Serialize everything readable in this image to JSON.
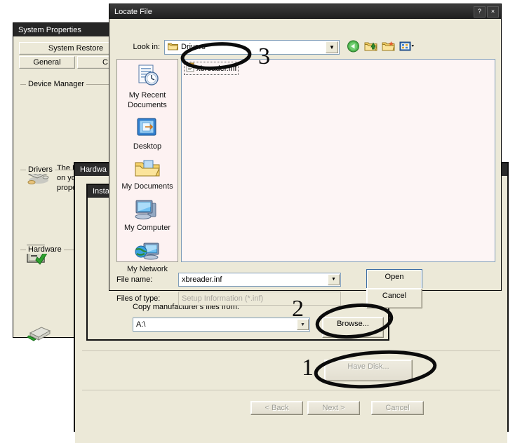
{
  "system_properties": {
    "title": "System Properties",
    "tabs": [
      "System Restore",
      "General",
      "C"
    ],
    "groups": [
      {
        "title": "Device Manager",
        "icon": "device-manager-icon",
        "text_lines": [
          "The Devic",
          "on your co",
          "properties"
        ]
      },
      {
        "title": "Drivers",
        "icon": "driver-signing-icon",
        "text_lines": []
      },
      {
        "title": "Hardware",
        "icon": "hardware-profiles-icon",
        "text_lines": []
      }
    ]
  },
  "hardware_wizard": {
    "title": "Hardwa",
    "buttons": {
      "have_disk": "Have Disk...",
      "back": "< Back",
      "next": "Next >",
      "cancel": "Cancel"
    }
  },
  "install_from_disk": {
    "title": "Insta",
    "copy_from_label": "Copy manufacturer's files from:",
    "path_value": "A:\\",
    "browse_label": "Browse..."
  },
  "locate_file": {
    "title": "Locate File",
    "help_button": "?",
    "close_button": "×",
    "look_in_label": "Look in:",
    "look_in_value": "Drivers",
    "toolbar": [
      {
        "name": "back-icon",
        "glyph": "◀"
      },
      {
        "name": "up-one-level-icon",
        "glyph": "↑"
      },
      {
        "name": "new-folder-icon",
        "glyph": "★"
      },
      {
        "name": "views-icon",
        "glyph": "▦"
      }
    ],
    "places": [
      {
        "name": "my-recent-documents",
        "label_line1": "My Recent",
        "label_line2": "Documents"
      },
      {
        "name": "desktop",
        "label_line1": "Desktop",
        "label_line2": ""
      },
      {
        "name": "my-documents",
        "label_line1": "My Documents",
        "label_line2": ""
      },
      {
        "name": "my-computer",
        "label_line1": "My Computer",
        "label_line2": ""
      },
      {
        "name": "my-network",
        "label_line1": "My Network",
        "label_line2": ""
      }
    ],
    "files": [
      {
        "name": "xbreader.inf",
        "selected": true
      }
    ],
    "file_name_label": "File name:",
    "file_name_value": "xbreader.inf",
    "files_of_type_label": "Files of type:",
    "files_of_type_value": "Setup Information (*.inf)",
    "open_label": "Open",
    "cancel_label": "Cancel"
  },
  "annotations": [
    {
      "id": "step-1",
      "number": "1",
      "target": "have-disk-button"
    },
    {
      "id": "step-2",
      "number": "2",
      "target": "browse-button"
    },
    {
      "id": "step-3",
      "number": "3",
      "target": "xbreader-inf-file"
    }
  ],
  "colors": {
    "dialog_face": "#ece9d8",
    "titlebar": "#2b2b2b",
    "list_background": "#fdf5f5",
    "annotation": "#0b0b0b",
    "disabled_text": "#9d9d94"
  }
}
